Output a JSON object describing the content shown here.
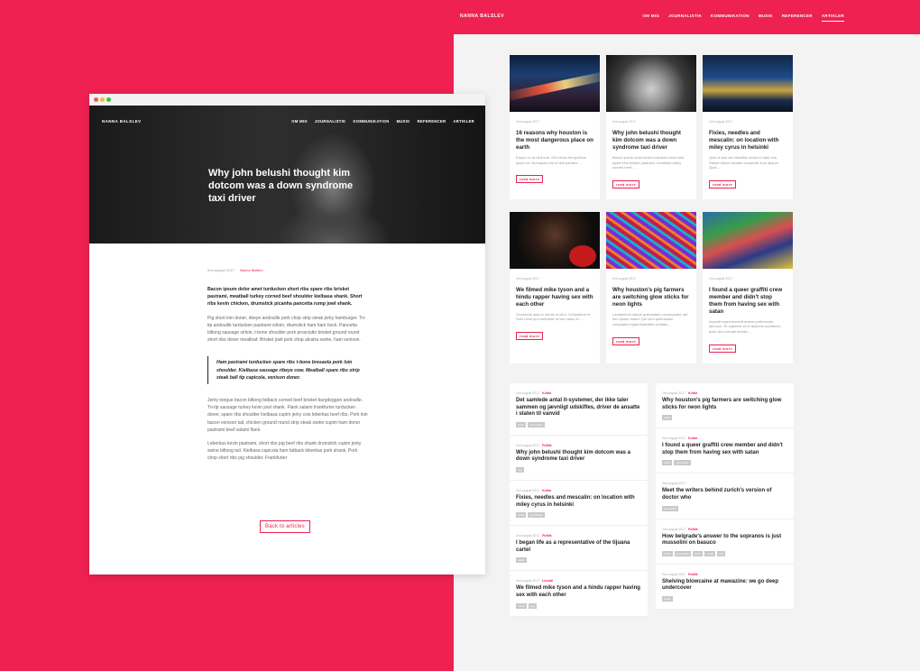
{
  "site": {
    "brand": "NANNA BALSLEV",
    "nav": [
      "OM MIG",
      "JOURNALISTIK",
      "KOMMUNIKATION",
      "MUSIK",
      "REFERENCER",
      "ARTIKLER"
    ],
    "cards": [
      {
        "date": "2nd august 2017",
        "title": "16 reasons why houston is the most dangerous place on earth",
        "excerpt": "Eaque ex id nihil iure. Est minus temporibus ipsum et. Numquam est id iste pariatur....",
        "readmore": "read more"
      },
      {
        "date": "2nd august 2017",
        "title": "Why john belushi thought kim dotcom was a down syndrome taxi driver",
        "excerpt": "Bacon ipsum dolor amet turducken short ribs spare ribs brisket pastrami, meatball turkey corned beef ....",
        "readmore": "read more"
      },
      {
        "date": "2nd august 2017",
        "title": "Fixies, needles and mescalin: on location with miley cyrus in helsinki",
        "excerpt": "Quis et iste vel blanditiis incidunt vitae eos. Saepe dolore beatae occaecati eum aliquid Quia....",
        "readmore": "read more"
      },
      {
        "date": "2nd august 2017",
        "title": "We filmed mike tyson and a hindu rapper having sex with each other",
        "excerpt": "Occaecati quia in omnis ut vero. Voluptatem et Sunt modi qui molestiae rerum natus et....",
        "readmore": "read more"
      },
      {
        "date": "2nd august 2017",
        "title": "Why houston's pig farmers are switching glow sticks for neon lights",
        "excerpt": "Laudantium saepe quibusdam consequatur aut iure ipsam autem Qui sunt quibusdam voluptates fugiat Blanditiis veritatis....",
        "readmore": "read more"
      },
      {
        "date": "2nd august 2017",
        "title": "I found a queer graffiti crew member and didn't stop them from having sex with satan",
        "excerpt": "Impedit reprehenderit autem perferendis laborum. Et sapiente et et dolorem architecto quia. Aut corrupti debitis....",
        "readmore": "read more"
      }
    ],
    "list_left": [
      {
        "date": "2nd august 2017",
        "category": "Kultur",
        "title": "Det samlede antal it-systemer, der ikke taler sammen og jævnligt udskiftes, driver de ansatte i staten til vanvid",
        "tags": [
          "kultur",
          "journalistik"
        ]
      },
      {
        "date": "2nd august 2017",
        "category": "Politik",
        "title": "Why john belushi thought kim dotcom was a down syndrome taxi driver",
        "tags": [
          "ting"
        ]
      },
      {
        "date": "2nd august 2017",
        "category": "Kultur",
        "title": "Fixies, needles and mescalin: on location with miley cyrus in helsinki",
        "tags": [
          "kultur",
          "journalistik"
        ]
      },
      {
        "date": "2nd august 2017",
        "category": "Politik",
        "title": "I began life as a representative of the tijuana cartel",
        "tags": [
          "politik"
        ]
      },
      {
        "date": "2nd august 2017",
        "category": "Livsstil",
        "title": "We filmed mike tyson and a hindu rapper having sex with each other",
        "tags": [
          "musik",
          "ting"
        ]
      }
    ],
    "list_right": [
      {
        "date": "2nd august 2017",
        "category": "Kultur",
        "title": "Why houston's pig farmers are switching glow sticks for neon lights",
        "tags": [
          "kultur"
        ]
      },
      {
        "date": "2nd august 2017",
        "category": "Kultur",
        "title": "I found a queer graffiti crew member and didn't stop them from having sex with satan",
        "tags": [
          "kultur",
          "journalistik"
        ]
      },
      {
        "date": "2nd august 2017",
        "category": "",
        "title": "Meet the writers behind zurich's version of doctor who",
        "tags": [
          "journalistik"
        ]
      },
      {
        "date": "2nd august 2017",
        "category": "Politik",
        "title": "How belgrade's answer to the sopranos is just mussolini on basuco",
        "tags": [
          "politik",
          "journalistik",
          "kultur",
          "musik",
          "ting"
        ]
      },
      {
        "date": "2nd august 2017",
        "category": "Politik",
        "title": "Shelving blowcaine at mawazine: we go deep undercover",
        "tags": [
          "politik"
        ]
      }
    ]
  },
  "article": {
    "brand": "NANNA BALSLEV",
    "nav": [
      "OM MIG",
      "JOURNALISTIK",
      "KOMMUNIKATION",
      "MUSIK",
      "REFERENCER",
      "ARTIKLER"
    ],
    "title": "Why john belushi thought kim dotcom was a down syndrome taxi driver",
    "date": "2nd august 2017",
    "author": "Nanna Balslev",
    "lead": "Bacon ipsum dolor amet turducken short ribs spare ribs brisket pastrami, meatball turkey corned beef shoulder kielbasa shank. Short ribs kevin chicken, drumstick picanha pancetta rump jowl shank.",
    "p1": "Pig short loin doner, ribeye andouille pork chop strip steak jerky hamburger. Tri-tip andouille turducken pastrami sirloin, drumstick ham ham hock. Pancetta biltong sausage sirloin, t-bone shoulder pork prosciutto brisket ground round short ribs doner meatloaf. Brisket jowl pork chop alcatra swine, ham venison.",
    "quote": "Ham pastrami turducken spare ribs t-bone bresaola pork loin shoulder. Kielbasa sausage ribeye cow. Meatball spare ribs strip steak ball tip capicola, venison doner.",
    "p2": "Jerky tongue bacon biltong fatback corned beef brisket burgdoggen andouille. Tri-tip sausage turkey kevin jowl shank. Flank salami frankfurter turducken doner, spare ribs shoulder kielbasa cupim jerky cow leberkas beef ribs. Pork loin bacon venison tail, chicken ground round strip steak swine cupim ham doner pastrami beef salami flank.",
    "p3": "Leberkas kevin pastrami, short ribs pig beef ribs shank drumstick cupim jerky swine biltong tail. Kielbasa capicola ham fatback leberkas pork shank. Pork chop short ribs pig shoulder. Frankfurter",
    "back": "Back to articles"
  },
  "colors": {
    "accent": "#ee2151",
    "page_bg": "#f3f3f3"
  }
}
